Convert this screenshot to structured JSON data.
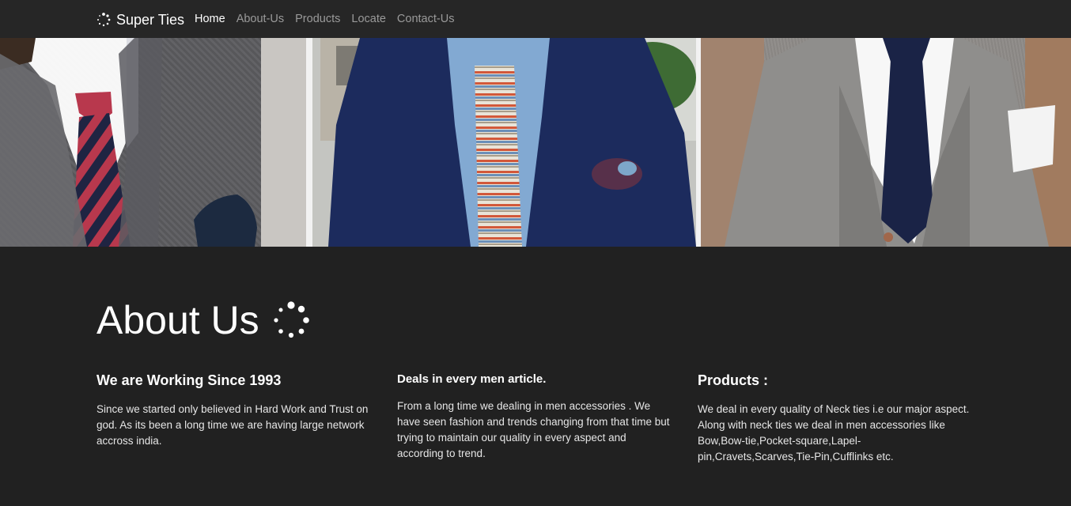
{
  "brand": {
    "name": "Super Ties",
    "icon": "spinner-dots-icon"
  },
  "nav": {
    "items": [
      {
        "label": "Home",
        "active": true
      },
      {
        "label": "About-Us",
        "active": false
      },
      {
        "label": "Products",
        "active": false
      },
      {
        "label": "Locate",
        "active": false
      },
      {
        "label": "Contact-Us",
        "active": false
      }
    ]
  },
  "hero": {
    "images": [
      "tie-photo-1",
      "tie-photo-2",
      "tie-photo-3"
    ]
  },
  "about": {
    "title": "About Us",
    "columns": [
      {
        "heading": "We are Working Since 1993",
        "text": "Since we started only believed in Hard Work and Trust on god. As its been a long time we are having large network accross india."
      },
      {
        "heading": "Deals in every men article.",
        "text": "From a long time we dealing in men accessories . We have seen fashion and trends changing from that time but trying to maintain our quality in every aspect and according to trend."
      },
      {
        "heading": "Products :",
        "text": "We deal in every quality of Neck ties i.e our major aspect. Along with neck ties we deal in men accessories like Bow,Bow-tie,Pocket-square,Lapel-pin,Cravets,Scarves,Tie-Pin,Cufflinks etc."
      }
    ]
  },
  "colors": {
    "background": "#212121",
    "navbar": "#262626",
    "nav_inactive": "#9a9a9a",
    "text": "#ffffff"
  }
}
